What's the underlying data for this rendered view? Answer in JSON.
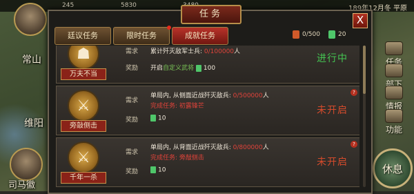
{
  "top_bar": {
    "stat1": "245",
    "stat2": "5830",
    "stat3": "3480",
    "date": "189年12月冬 平原"
  },
  "map": {
    "city1": "常山",
    "city2": "维阳",
    "commander": "司马徽"
  },
  "side_menu": [
    {
      "label": "任务"
    },
    {
      "label": "部下"
    },
    {
      "label": "情报"
    },
    {
      "label": "功能"
    }
  ],
  "rest_button": "休息",
  "dialog": {
    "title": "任务",
    "close": "X",
    "tabs": [
      {
        "label": "廷议任务"
      },
      {
        "label": "限时任务"
      },
      {
        "label": "成就任务"
      }
    ],
    "resources": {
      "order": "0/500",
      "jade": "20"
    }
  },
  "labels": {
    "require": "需求",
    "reward": "奖励"
  },
  "tasks": [
    {
      "name": "万夫不当",
      "requirement_prefix": "累计歼灭敌军士兵: ",
      "requirement_progress": "0/100000",
      "requirement_suffix": "人",
      "reward_prefix": "开启",
      "reward_link": "自定义武将",
      "reward_amount": "100",
      "status": "进行中"
    },
    {
      "name": "旁敲侧击",
      "requirement_prefix": "单局内, 从侧面近战歼灭敌兵: ",
      "requirement_progress": "0/500000",
      "requirement_suffix": "人",
      "complete_note": "完成任务: 初露锋芒",
      "reward_amount": "10",
      "status": "未开启",
      "help": "?"
    },
    {
      "name": "千年一杀",
      "requirement_prefix": "单局内, 从背面近战歼灭敌兵: ",
      "requirement_progress": "0/800000",
      "requirement_suffix": "人",
      "complete_note": "完成任务: 旁敲侧击",
      "reward_amount": "10",
      "status": "未开启",
      "help": "?"
    }
  ]
}
